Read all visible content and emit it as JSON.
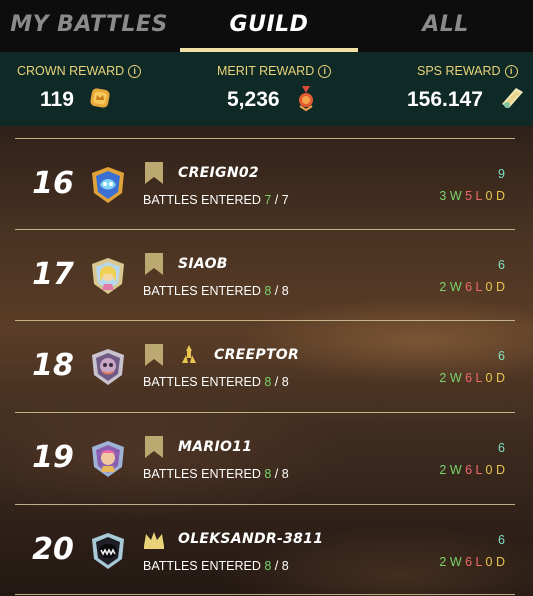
{
  "tabs": [
    {
      "label": "MY BATTLES",
      "active": false
    },
    {
      "label": "GUILD",
      "active": true
    },
    {
      "label": "ALL",
      "active": false
    }
  ],
  "rewards": {
    "crown": {
      "label": "CROWN REWARD",
      "value": "119",
      "icon": "crown-token-icon"
    },
    "merit": {
      "label": "MERIT REWARD",
      "value": "5,236",
      "icon": "merit-medal-icon"
    },
    "sps": {
      "label": "SPS REWARD",
      "value": "156.147",
      "icon": "sps-token-icon"
    },
    "info_glyph": "i"
  },
  "colors": {
    "accent": "#efe0a6",
    "reward_label": "#e9d27a",
    "win": "#7bd36b",
    "loss": "#f06a6a",
    "draw": "#e9c64f",
    "score": "#7fe0c0"
  },
  "battles_label": "BATTLES ENTERED",
  "players": [
    {
      "rank": "16",
      "name": "CREIGN02",
      "entered": "7",
      "total": "7",
      "score": "9",
      "wins": "3",
      "losses": "5",
      "draws": "0",
      "icon": "bookmark-banner-icon",
      "title_icon": ""
    },
    {
      "rank": "17",
      "name": "SIAOB",
      "entered": "8",
      "total": "8",
      "score": "6",
      "wins": "2",
      "losses": "6",
      "draws": "0",
      "icon": "bookmark-banner-icon",
      "title_icon": ""
    },
    {
      "rank": "18",
      "name": "CREEPTOR",
      "entered": "8",
      "total": "8",
      "score": "6",
      "wins": "2",
      "losses": "6",
      "draws": "0",
      "icon": "bookmark-banner-icon",
      "title_icon": "warrior-title-icon"
    },
    {
      "rank": "19",
      "name": "MARIO11",
      "entered": "8",
      "total": "8",
      "score": "6",
      "wins": "2",
      "losses": "6",
      "draws": "0",
      "icon": "bookmark-banner-icon",
      "title_icon": ""
    },
    {
      "rank": "20",
      "name": "OLEKSANDR-3811",
      "entered": "8",
      "total": "8",
      "score": "6",
      "wins": "2",
      "losses": "6",
      "draws": "0",
      "icon": "crown-icon",
      "title_icon": ""
    }
  ],
  "units": {
    "win": "W",
    "loss": "L",
    "draw": "D",
    "sep": "/"
  }
}
